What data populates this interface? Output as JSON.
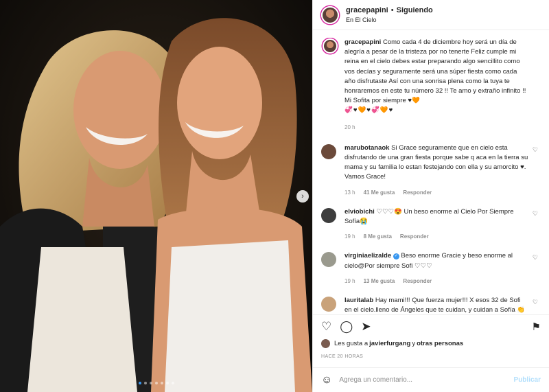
{
  "header": {
    "username": "gracepapini",
    "separator": "•",
    "follow_state": "Siguiendo",
    "location": "En El Cielo"
  },
  "caption": {
    "username": "gracepapini",
    "text": "Como cada 4 de diciembre hoy será un día de alegría a pesar de la tristeza por no tenerte Feliz cumple mi reina en el cielo debes estar preparando algo sencillito como vos decías y seguramente será una súper fiesta como cada año disfrutaste Así con una sonrisa plena como la tuya te honraremos en este tu número 32 !! Te amo y extraño infinito !! Mi Sofita por siempre ♥🧡",
    "emoji_line": "💞♥🧡♥💞🧡♥",
    "time": "20 h"
  },
  "comments": [
    {
      "username": "marubotanaok",
      "text": "Si Grace seguramente que en cielo esta disfrutando de una gran fiesta porque sabe q aca en la tierra su mama y su familia lo estan festejando con ella y su amorcito ♥. Vamos Grace!",
      "time": "13 h",
      "likes": "41 Me gusta",
      "reply": "Responder",
      "avatar_color": "#6b4a3a"
    },
    {
      "username": "elviobichi",
      "text": "♡♡♡😍 Un beso enorme al Cielo Por Siempre Sofía😭",
      "time": "19 h",
      "likes": "8 Me gusta",
      "reply": "Responder",
      "avatar_color": "#3d3d3d"
    },
    {
      "username": "virginiaelizalde",
      "text": "Beso enorme Gracie y beso enorme al cielo@Por siempre Sofi ♡♡♡",
      "time": "19 h",
      "likes": "13 Me gusta",
      "reply": "Responder",
      "avatar_color": "#9a9a8e"
    },
    {
      "username": "lauritalab",
      "text": "Hay mami!!! Que fuerza mujer!!! X esos 32 de Sofi en el cielo.lleno de Ángeles que te cuidan, y cuidan a Sofía 👏🔥😭♥♥",
      "time": "",
      "likes": "",
      "reply": "",
      "avatar_color": "#c9a27a"
    }
  ],
  "verified_mark": "✓",
  "comment_like_icon": "♡",
  "actions": {
    "like_icon": "♡",
    "comment_icon": "◯",
    "share_icon": "➤",
    "save_icon": "⚑"
  },
  "likes": {
    "prefix": "Les gusta a ",
    "user": "javierfurgang",
    "suffix": " y ",
    "others": "otras personas"
  },
  "posted": "HACE 20 HORAS",
  "add_comment": {
    "emoji_icon": "☺",
    "placeholder": "Agrega un comentario...",
    "publish": "Publicar"
  },
  "carousel": {
    "next_icon": "›",
    "slide_count": 7,
    "active_index": 0
  }
}
